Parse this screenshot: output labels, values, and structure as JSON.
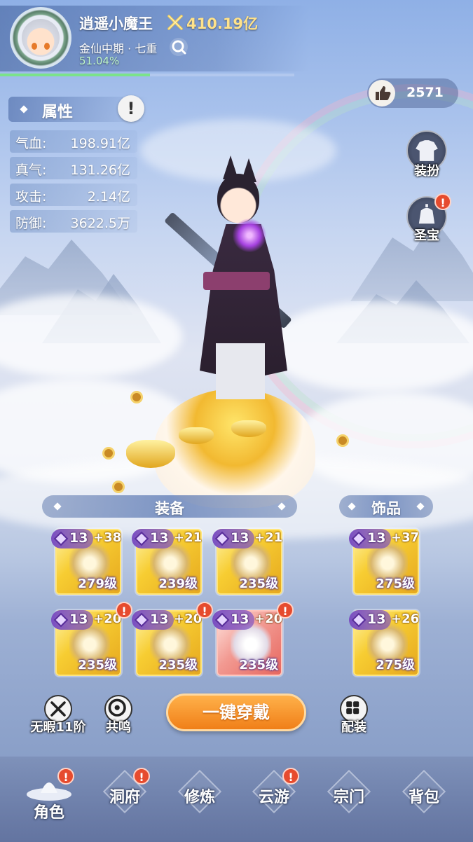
{
  "player": {
    "name": "逍遥小魔王",
    "combat_power": "410.19亿",
    "realm": "金仙中期 · 七重",
    "progress_text": "51.04%",
    "progress_fraction": 0.5104
  },
  "likes": {
    "count": "2571"
  },
  "attributes": {
    "title": "属性",
    "info_glyph": "!",
    "rows": [
      {
        "label": "气血:",
        "value": "198.91亿"
      },
      {
        "label": "真气:",
        "value": "131.26亿"
      },
      {
        "label": "攻击:",
        "value": "2.14亿"
      },
      {
        "label": "防御:",
        "value": "3622.5万"
      }
    ]
  },
  "side_buttons": {
    "dress": {
      "label": "装扮",
      "icon": "robe-icon"
    },
    "treasure": {
      "label": "圣宝",
      "icon": "bell-icon",
      "badge": "!"
    }
  },
  "equipment": {
    "title": "装备",
    "slots": [
      {
        "gem": "13",
        "plus": "+38",
        "level": "279级",
        "icon": "sword-icon",
        "badge": ""
      },
      {
        "gem": "13",
        "plus": "+21",
        "level": "239级",
        "icon": "crown-icon",
        "badge": ""
      },
      {
        "gem": "13",
        "plus": "+21",
        "level": "235级",
        "icon": "armor-icon",
        "badge": ""
      },
      {
        "gem": "13",
        "plus": "+20",
        "level": "235级",
        "icon": "skirt-icon",
        "badge": "!"
      },
      {
        "gem": "13",
        "plus": "+20",
        "level": "235级",
        "icon": "gauntlet-icon",
        "badge": "!"
      },
      {
        "gem": "13",
        "plus": "+20",
        "level": "235级",
        "icon": "boots-icon",
        "badge": "!",
        "rarity": "red"
      }
    ]
  },
  "accessories": {
    "title": "饰品",
    "slots": [
      {
        "gem": "13",
        "plus": "+37",
        "level": "275级",
        "icon": "ring-icon"
      },
      {
        "gem": "13",
        "plus": "+26",
        "level": "275级",
        "icon": "pendant-icon"
      }
    ]
  },
  "actions": {
    "flawless": "无暇11阶",
    "resonance": "共鸣",
    "equip_all": "一键穿戴",
    "loadout": "配装"
  },
  "nav": [
    {
      "label": "角色",
      "active": true,
      "badge": "!"
    },
    {
      "label": "洞府",
      "active": false,
      "badge": "!"
    },
    {
      "label": "修炼",
      "active": false,
      "badge": ""
    },
    {
      "label": "云游",
      "active": false,
      "badge": "!"
    },
    {
      "label": "宗门",
      "active": false,
      "badge": ""
    },
    {
      "label": "背包",
      "active": false,
      "badge": ""
    }
  ],
  "colors": {
    "accent_orange": "#f07f18",
    "badge_red": "#e64b2e",
    "gold_frame": "#f7cd32",
    "red_frame": "#e7675f",
    "gem_purple": "#7b4fc1",
    "progress_green": "#7be38a"
  }
}
